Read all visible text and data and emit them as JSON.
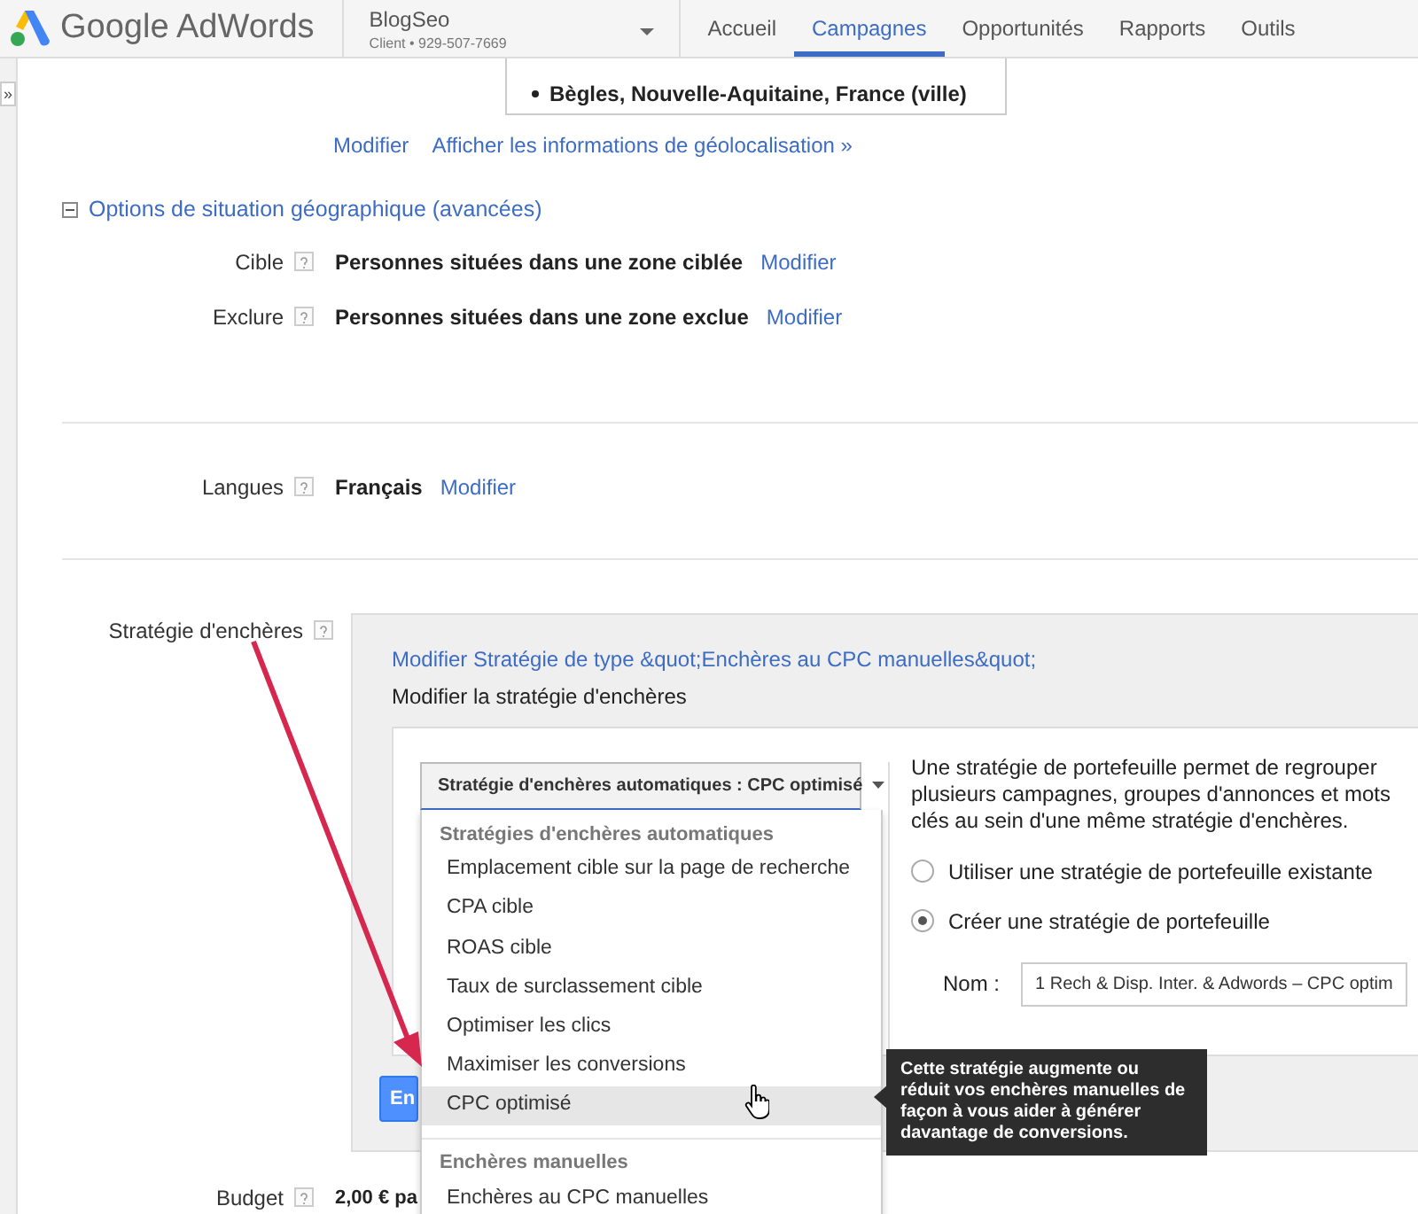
{
  "header": {
    "logo": "Google AdWords",
    "account": {
      "name": "BlogSeo",
      "detail": "Client • 929-507-7669"
    },
    "nav": [
      {
        "label": "Accueil",
        "selected": false
      },
      {
        "label": "Campagnes",
        "selected": true
      },
      {
        "label": "Opportunités",
        "selected": false
      },
      {
        "label": "Rapports",
        "selected": false
      },
      {
        "label": "Outils",
        "selected": false
      }
    ]
  },
  "sidebar_toggle": "»",
  "locations": [
    "Bègles, Nouvelle-Aquitaine, France (ville)"
  ],
  "location_links": [
    "Modifier",
    "Afficher les informations de géolocalisation »"
  ],
  "advanced": {
    "title": "Options de situation géographique (avancées)",
    "expanded": true,
    "rows": [
      {
        "label": "Cible",
        "value": "Personnes situées dans une zone ciblée",
        "link": "Modifier"
      },
      {
        "label": "Exclure",
        "value": "Personnes situées dans une zone exclue",
        "link": "Modifier"
      }
    ]
  },
  "languages": {
    "label": "Langues",
    "value": "Français",
    "link": "Modifier"
  },
  "bidding": {
    "label": "Stratégie d'enchères",
    "edit_link": "Modifier Stratégie de type &quot;Enchères au CPC manuelles&quot;",
    "subtitle": "Modifier la stratégie d'enchères",
    "select": "Stratégie d'enchères automatiques : CPC optimisé",
    "description": "Une stratégie de portefeuille permet de regrouper plusieurs campagnes, groupes d'annonces et mots clés au sein d'une même stratégie d'enchères.",
    "radios": [
      {
        "label": "Utiliser une stratégie de portefeuille existante",
        "checked": false
      },
      {
        "label": "Créer une stratégie de portefeuille",
        "checked": true
      }
    ],
    "name_label": "Nom :",
    "name_value": "1 Rech & Disp. Inter. & Adwords – CPC optim",
    "save_button": "En"
  },
  "budget": {
    "label": "Budget",
    "value": "2,00 € pa"
  },
  "dropdown": [
    {
      "kind": "header",
      "label": "Stratégies d'enchères automatiques"
    },
    {
      "kind": "option",
      "label": "Emplacement cible sur la page de recherche",
      "selected": false
    },
    {
      "kind": "option",
      "label": "CPA cible",
      "selected": false
    },
    {
      "kind": "option",
      "label": "ROAS cible",
      "selected": false
    },
    {
      "kind": "option",
      "label": "Taux de surclassement cible",
      "selected": false
    },
    {
      "kind": "option",
      "label": "Optimiser les clics",
      "selected": false
    },
    {
      "kind": "option",
      "label": "Maximiser les conversions",
      "selected": false
    },
    {
      "kind": "option",
      "label": "CPC optimisé",
      "selected": true
    },
    {
      "kind": "divider"
    },
    {
      "kind": "header",
      "label": "Enchères manuelles"
    },
    {
      "kind": "option",
      "label": "Enchères au CPC manuelles",
      "selected": false
    }
  ],
  "tooltip": "Cette stratégie augmente ou réduit vos enchères manuelles de façon à vous aider à générer davantage de conversions."
}
